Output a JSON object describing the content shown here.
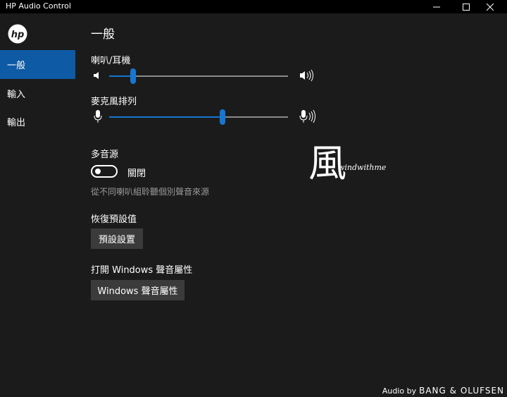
{
  "window": {
    "title": "HP Audio Control"
  },
  "sidebar": {
    "logo": "hp-logo-icon",
    "items": [
      {
        "label": "一般",
        "active": true
      },
      {
        "label": "輸入",
        "active": false
      },
      {
        "label": "輸出",
        "active": false
      }
    ]
  },
  "main": {
    "title": "一般",
    "speakers": {
      "label": "喇叭/耳機",
      "level": 0.12,
      "icon_low": "speaker-low-icon",
      "icon_high": "speaker-high-icon"
    },
    "mic_array": {
      "label": "麥克風排列",
      "level": 0.64,
      "icon_low": "microphone-low-icon",
      "icon_high": "microphone-high-icon"
    },
    "multi_source": {
      "label": "多音源",
      "state_label": "關閉",
      "on": false,
      "description": "從不同喇叭組聆聽個別聲音來源"
    },
    "restore": {
      "label": "恢復預設值",
      "button": "預設設置"
    },
    "open_sound": {
      "label": "打開 Windows 聲音屬性",
      "button": "Windows 聲音屬性"
    }
  },
  "watermark": {
    "char": "風",
    "text": "windwithme"
  },
  "footer": {
    "prefix": "Audio by",
    "brand": "BANG & OLUFSEN"
  },
  "colors": {
    "accent": "#1676d2",
    "nav_active": "#0e5aa5",
    "background": "#1b1b1b",
    "titlebar": "#000000",
    "button": "#3b3b3b"
  }
}
